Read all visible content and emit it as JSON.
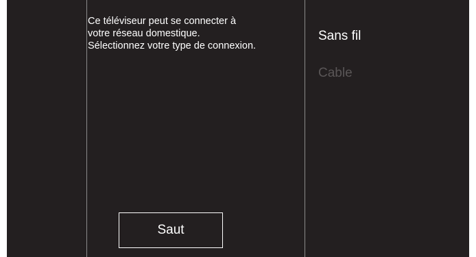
{
  "info": {
    "line1": "Ce téléviseur peut se connecter à",
    "line2": "votre réseau domestique.",
    "line3": "Sélectionnez votre type de connexion."
  },
  "skip_button": {
    "label": "Saut"
  },
  "options": [
    {
      "label": "Sans fil",
      "state": "selected",
      "color": "#ffffff"
    },
    {
      "label": "Cable",
      "state": "dimmed",
      "color": "#5a5657"
    }
  ],
  "colors": {
    "background": "#231f20",
    "divider": "#8c8c8c",
    "text": "#ffffff"
  }
}
